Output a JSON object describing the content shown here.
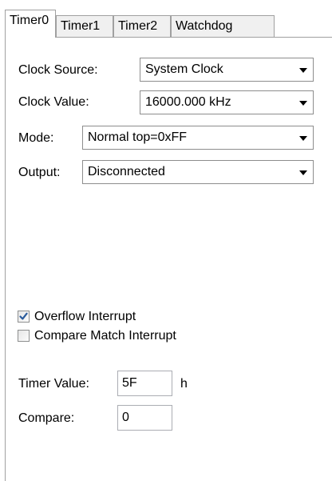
{
  "tabs": [
    {
      "label": "Timer0",
      "active": true
    },
    {
      "label": "Timer1",
      "active": false
    },
    {
      "label": "Timer2",
      "active": false
    },
    {
      "label": "Watchdog",
      "active": false
    }
  ],
  "form": {
    "clock_source": {
      "label": "Clock Source:",
      "value": "System Clock"
    },
    "clock_value": {
      "label": "Clock Value:",
      "value": "16000.000 kHz"
    },
    "mode": {
      "label": "Mode:",
      "value": "Normal top=0xFF"
    },
    "output": {
      "label": "Output:",
      "value": "Disconnected"
    }
  },
  "checkboxes": [
    {
      "label": "Overflow Interrupt",
      "checked": true
    },
    {
      "label": "Compare Match Interrupt",
      "checked": false
    }
  ],
  "timer_value": {
    "label": "Timer Value:",
    "value": "5F",
    "suffix": "h"
  },
  "compare": {
    "label": "Compare:",
    "value": "0"
  },
  "colors": {
    "tab_border": "#a0a0a0",
    "inactive_tab_bg": "#f0f0f0",
    "check_blue": "#2a5b9c"
  },
  "icons": {
    "dropdown": "chevron-down-icon",
    "check": "check-icon"
  }
}
